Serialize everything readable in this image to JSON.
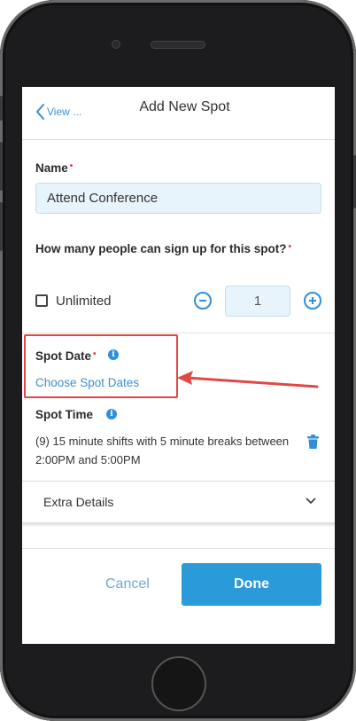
{
  "header": {
    "back_label": "View ...",
    "title": "Add New Spot"
  },
  "form": {
    "name_label": "Name",
    "name_value": "Attend Conference",
    "capacity_label": "How many people can sign up for this spot?",
    "unlimited_label": "Unlimited",
    "unlimited_checked": false,
    "quantity": "1",
    "spot_date_label": "Spot Date",
    "choose_dates_link": "Choose Spot Dates",
    "spot_time_label": "Spot Time",
    "spot_time_text": "(9) 15 minute shifts with 5 minute breaks between 2:00PM and 5:00PM",
    "extra_details_label": "Extra Details",
    "required_marker": "•"
  },
  "footer": {
    "cancel_label": "Cancel",
    "done_label": "Done"
  },
  "colors": {
    "accent": "#2b9ad9",
    "link": "#3d8fcf",
    "required": "#e2343a",
    "annotation": "#e04848",
    "input_bg": "#e8f4fb"
  },
  "icons": [
    "chevron-left-icon",
    "minus-circle-icon",
    "plus-circle-icon",
    "info-icon",
    "trash-icon",
    "chevron-down-icon"
  ]
}
